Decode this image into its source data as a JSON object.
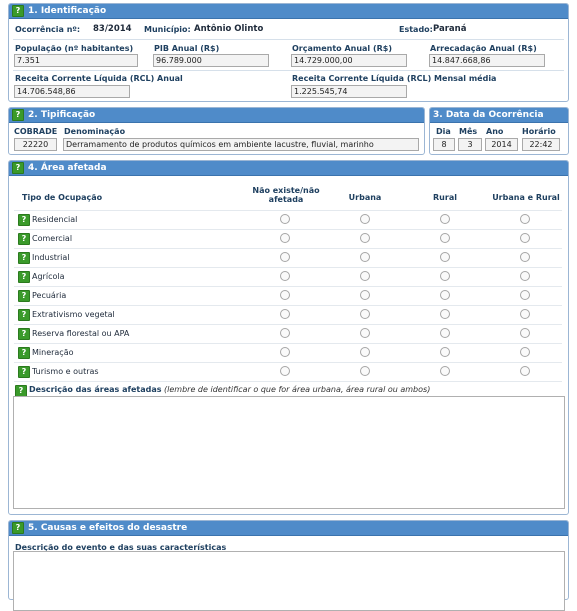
{
  "section1": {
    "title": "1. Identificação",
    "ocorrencia_label": "Ocorrência nº:",
    "ocorrencia_value": "83/2014",
    "municipio_label": "Município:",
    "municipio_value": "Antônio Olinto",
    "estado_label": "Estado:",
    "estado_value": "Paraná",
    "populacao_label": "População (nº habitantes)",
    "populacao_value": "7.351",
    "pib_label": "PIB Anual (R$)",
    "pib_value": "96.789.000",
    "orcamento_label": "Orçamento Anual (R$)",
    "orcamento_value": "14.729.000,00",
    "arrecadacao_label": "Arrecadação Anual (R$)",
    "arrecadacao_value": "14.847.668,86",
    "rcl_anual_label": "Receita Corrente Líquida (RCL) Anual",
    "rcl_anual_value": "14.706.548,86",
    "rcl_mensal_label": "Receita Corrente Líquida (RCL) Mensal média",
    "rcl_mensal_value": "1.225.545,74"
  },
  "section2": {
    "title": "2. Tipificação",
    "cobrade_label": "COBRADE",
    "cobrade_value": "22220",
    "denominacao_label": "Denominação",
    "denominacao_value": "Derramamento de produtos químicos em ambiente lacustre, fluvial, marinho"
  },
  "section3": {
    "title": "3. Data da Ocorrência",
    "dia_label": "Dia",
    "dia_value": "8",
    "mes_label": "Mês",
    "mes_value": "3",
    "ano_label": "Ano",
    "ano_value": "2014",
    "horario_label": "Horário",
    "horario_value": "22:42"
  },
  "section4": {
    "title": "4. Área afetada",
    "col_tipo": "Tipo de Ocupação",
    "col_nao_existe": "Não existe/não afetada",
    "col_urbana": "Urbana",
    "col_rural": "Rural",
    "col_urbana_rural": "Urbana e Rural",
    "rows": [
      {
        "label": "Residencial"
      },
      {
        "label": "Comercial"
      },
      {
        "label": "Industrial"
      },
      {
        "label": "Agrícola"
      },
      {
        "label": "Pecuária"
      },
      {
        "label": "Extrativismo vegetal"
      },
      {
        "label": "Reserva florestal ou APA"
      },
      {
        "label": "Mineração"
      },
      {
        "label": "Turismo e outras"
      }
    ],
    "descricao_label": "Descrição das áreas afetadas",
    "descricao_hint": "(lembre de identificar o que for área urbana, área rural ou ambos)"
  },
  "section5": {
    "title": "5. Causas e efeitos do desastre",
    "descricao_label": "Descrição do evento e das suas características"
  },
  "colors": {
    "header_blue": "#4f8bc9",
    "help_green": "#3a9a2a",
    "label_navy": "#1f4060"
  }
}
